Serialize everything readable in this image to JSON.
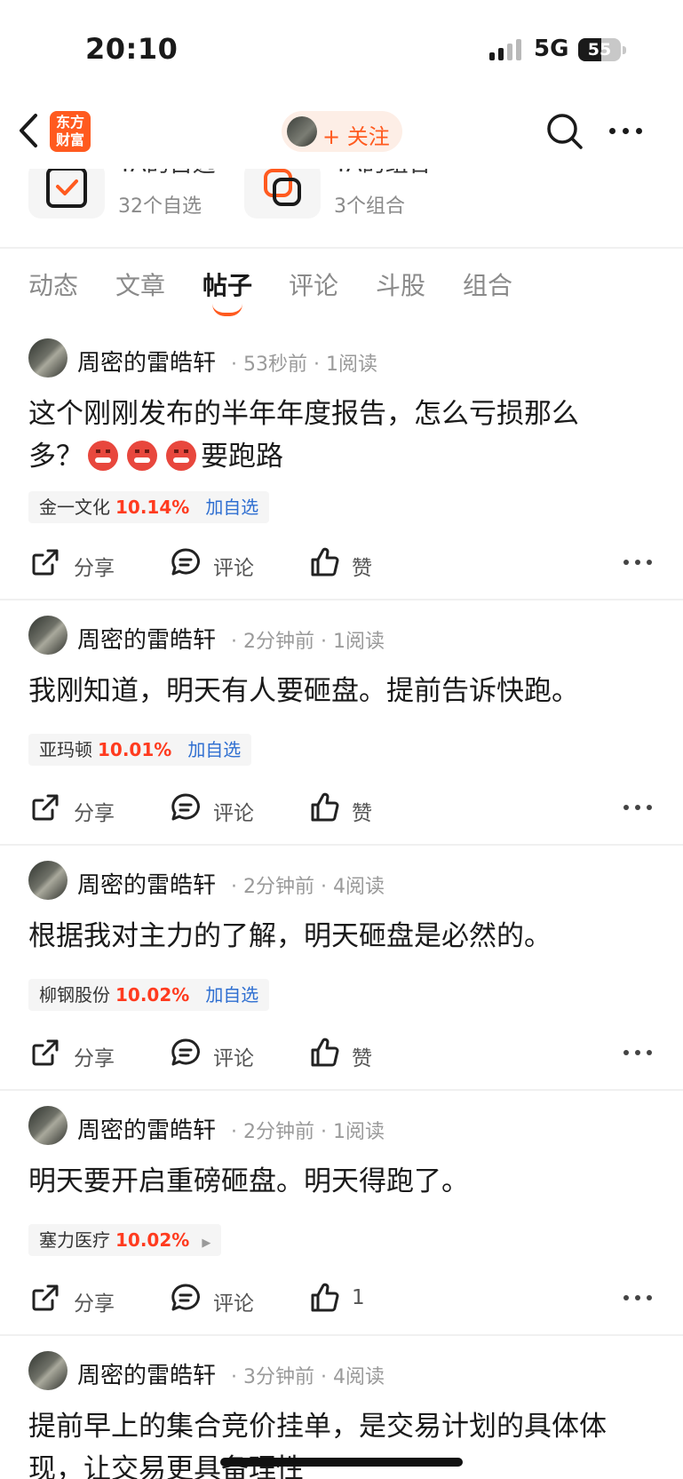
{
  "status_bar": {
    "time": "20:10",
    "network": "5G",
    "battery": "55"
  },
  "nav": {
    "logo_line1": "东方",
    "logo_line2": "财富",
    "follow_label": "+ 关注"
  },
  "profile_cards": [
    {
      "title": "TA的自选",
      "sub": "32个自选"
    },
    {
      "title": "TA的组合",
      "sub": "3个组合"
    }
  ],
  "tabs": [
    "动态",
    "文章",
    "帖子",
    "评论",
    "斗股",
    "组合"
  ],
  "active_tab": "帖子",
  "action_labels": {
    "share": "分享",
    "comment": "评论",
    "like": "赞"
  },
  "posts": [
    {
      "author": "周密的雷皓轩",
      "time": "53秒前",
      "reads": "1阅读",
      "content_line1": "这个刚刚发布的半年年度报告，怎么亏损那么",
      "content_line2_prefix": "多？",
      "content_line2_suffix": "要跑路",
      "stock": {
        "name": "金一文化",
        "pct": "10.14%",
        "add": "加自选"
      },
      "like": "赞"
    },
    {
      "author": "周密的雷皓轩",
      "time": "2分钟前",
      "reads": "1阅读",
      "content": "我刚知道，明天有人要砸盘。提前告诉快跑。",
      "stock": {
        "name": "亚玛顿",
        "pct": "10.01%",
        "add": "加自选"
      },
      "like": "赞"
    },
    {
      "author": "周密的雷皓轩",
      "time": "2分钟前",
      "reads": "4阅读",
      "content": "根据我对主力的了解，明天砸盘是必然的。",
      "stock": {
        "name": "柳钢股份",
        "pct": "10.02%",
        "add": "加自选"
      },
      "like": "赞"
    },
    {
      "author": "周密的雷皓轩",
      "time": "2分钟前",
      "reads": "1阅读",
      "content": "明天要开启重磅砸盘。明天得跑了。",
      "stock": {
        "name": "塞力医疗",
        "pct": "10.02%",
        "arrow": "▶"
      },
      "like": "1"
    },
    {
      "author": "周密的雷皓轩",
      "time": "3分钟前",
      "reads": "4阅读",
      "content_line1": "提前早上的集合竞价挂单，是交易计划的具体体",
      "content_line2": "现，让交易更具备理性"
    }
  ]
}
